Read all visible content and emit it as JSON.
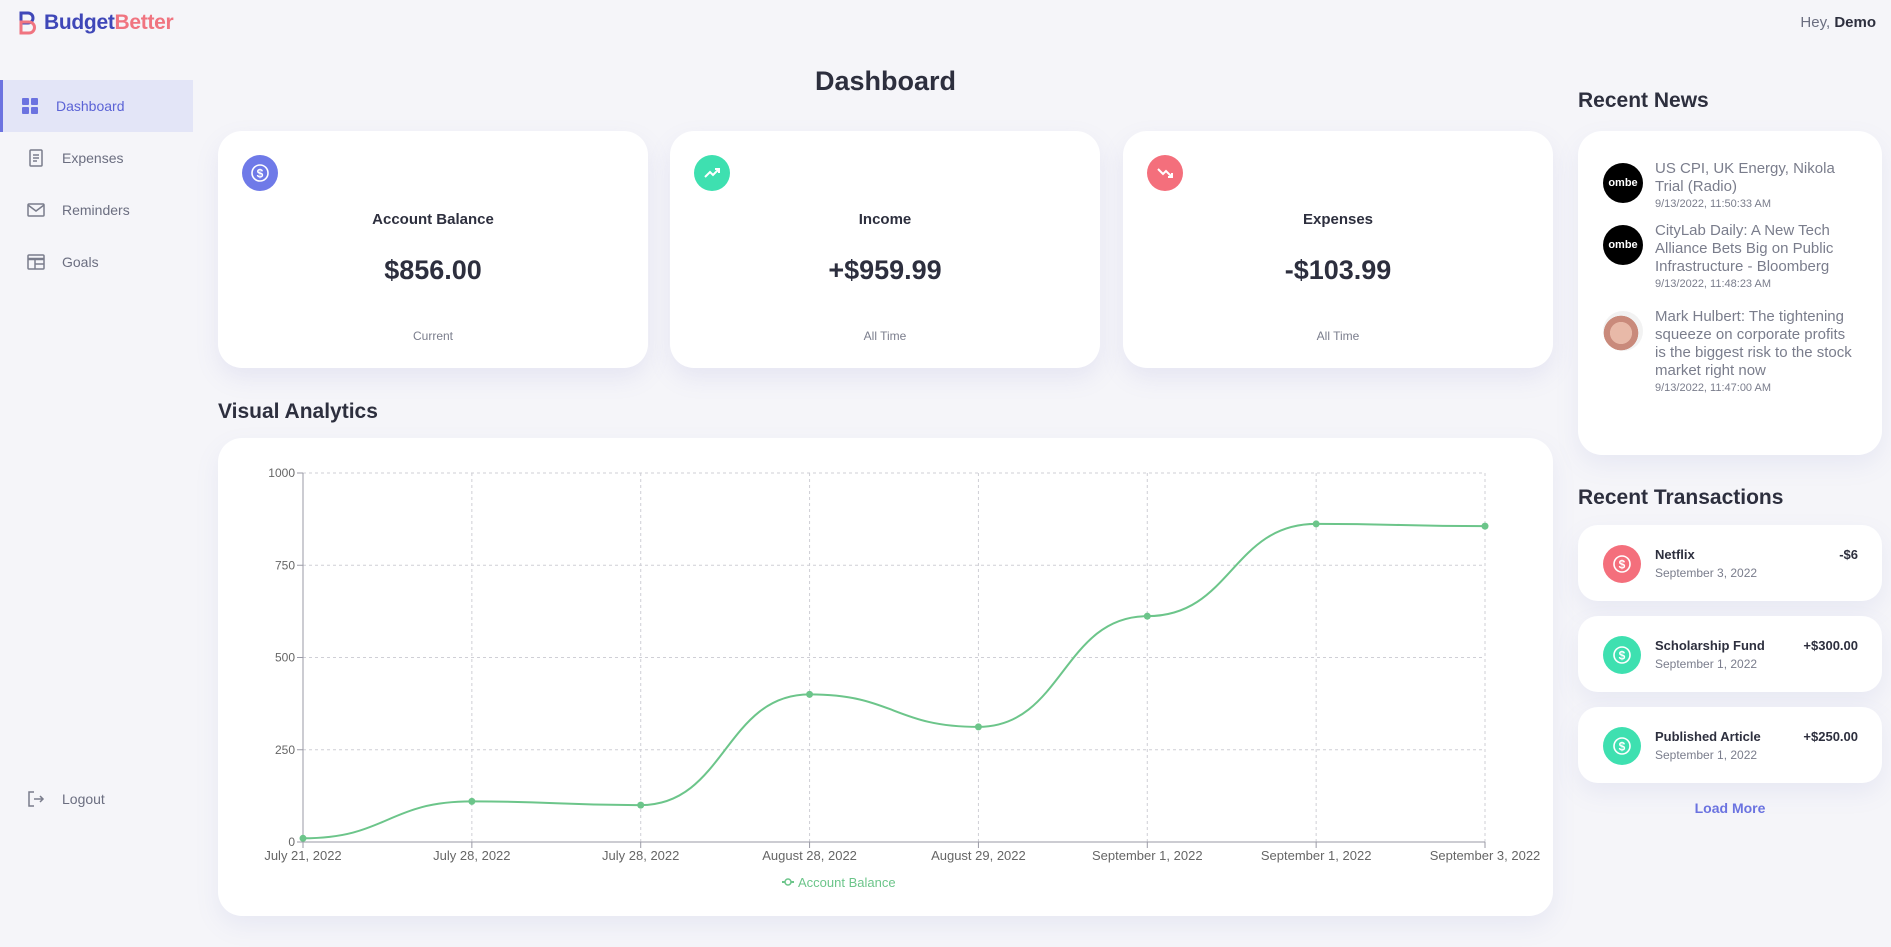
{
  "header": {
    "brand_part1": "Budget",
    "brand_part2": "Better",
    "greeting_prefix": "Hey,",
    "user_name": "Demo"
  },
  "sidebar": {
    "items": [
      {
        "label": "Dashboard",
        "icon": "grid-icon"
      },
      {
        "label": "Expenses",
        "icon": "receipt-icon"
      },
      {
        "label": "Reminders",
        "icon": "mail-icon"
      },
      {
        "label": "Goals",
        "icon": "table-icon"
      }
    ],
    "logout_label": "Logout"
  },
  "page_title": "Dashboard",
  "cards": [
    {
      "title": "Account Balance",
      "value": "$856.00",
      "caption": "Current",
      "icon": "dollar-icon",
      "color": "#6f7ae8"
    },
    {
      "title": "Income",
      "value": "+$959.99",
      "caption": "All Time",
      "icon": "trending-up-icon",
      "color": "#3ee0b0"
    },
    {
      "title": "Expenses",
      "value": "-$103.99",
      "caption": "All Time",
      "icon": "trending-down-icon",
      "color": "#f46f7c"
    }
  ],
  "visual_analytics_title": "Visual Analytics",
  "chart_data": {
    "type": "line",
    "x": [
      "July 21, 2022",
      "July 28, 2022",
      "July 28, 2022",
      "August 28, 2022",
      "August 29, 2022",
      "September 1, 2022",
      "September 1, 2022",
      "September 3, 2022"
    ],
    "series": [
      {
        "name": "Account Balance",
        "values": [
          10,
          110,
          100,
          400,
          312,
          612,
          862,
          856
        ],
        "color": "#6cc58a"
      }
    ],
    "ylim": [
      0,
      1000
    ],
    "yticks": [
      0,
      250,
      500,
      750,
      1000
    ],
    "grid": true,
    "legend": "bottom"
  },
  "recent_news": {
    "title": "Recent News",
    "items": [
      {
        "headline": "US CPI, UK Energy, Nikola Trial (Radio)",
        "date": "9/13/2022, 11:50:33 AM",
        "thumb_text": "ombe"
      },
      {
        "headline": "CityLab Daily: A New Tech Alliance Bets Big on Public Infrastructure - Bloomberg",
        "date": "9/13/2022, 11:48:23 AM",
        "thumb_text": "ombe"
      },
      {
        "headline": "Mark Hulbert: The tightening squeeze on corporate profits is the biggest risk to the stock market right now",
        "date": "9/13/2022, 11:47:00 AM",
        "thumb_text": ""
      }
    ]
  },
  "recent_transactions": {
    "title": "Recent Transactions",
    "items": [
      {
        "name": "Netflix",
        "date": "September 3, 2022",
        "amount": "-$6",
        "color": "#f46f7c"
      },
      {
        "name": "Scholarship Fund",
        "date": "September 1, 2022",
        "amount": "+$300.00",
        "color": "#3ee0b0"
      },
      {
        "name": "Published Article",
        "date": "September 1, 2022",
        "amount": "+$250.00",
        "color": "#3ee0b0"
      }
    ],
    "load_more_label": "Load More"
  }
}
